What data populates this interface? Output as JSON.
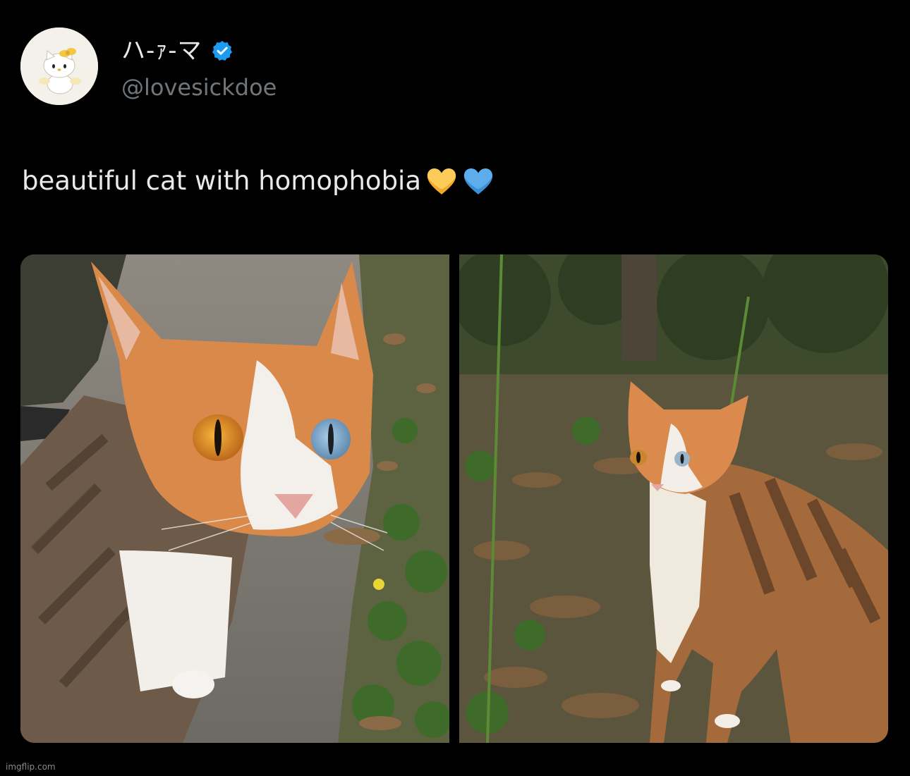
{
  "author": {
    "display_name": "ハ-ｧ-マ",
    "handle": "@lovesickdoe",
    "avatar_icon": "hello-kitty-avatar",
    "verified_icon": "verified-badge-icon",
    "verified_color": "#1d9bf0"
  },
  "tweet": {
    "text": "beautiful cat with homophobia",
    "emojis": [
      "yellow-heart-icon",
      "blue-heart-icon"
    ],
    "emoji_colors": [
      "#fdcb58",
      "#5dadec"
    ]
  },
  "media": {
    "images": [
      {
        "subject": "close-up of orange and white cat with one amber eye and one blue eye"
      },
      {
        "subject": "orange and tabby cat standing among leaves and plants"
      }
    ]
  },
  "watermark": "imgflip.com",
  "colors": {
    "background": "#000000",
    "text": "#e7e9ea",
    "secondary_text": "#71767b"
  }
}
